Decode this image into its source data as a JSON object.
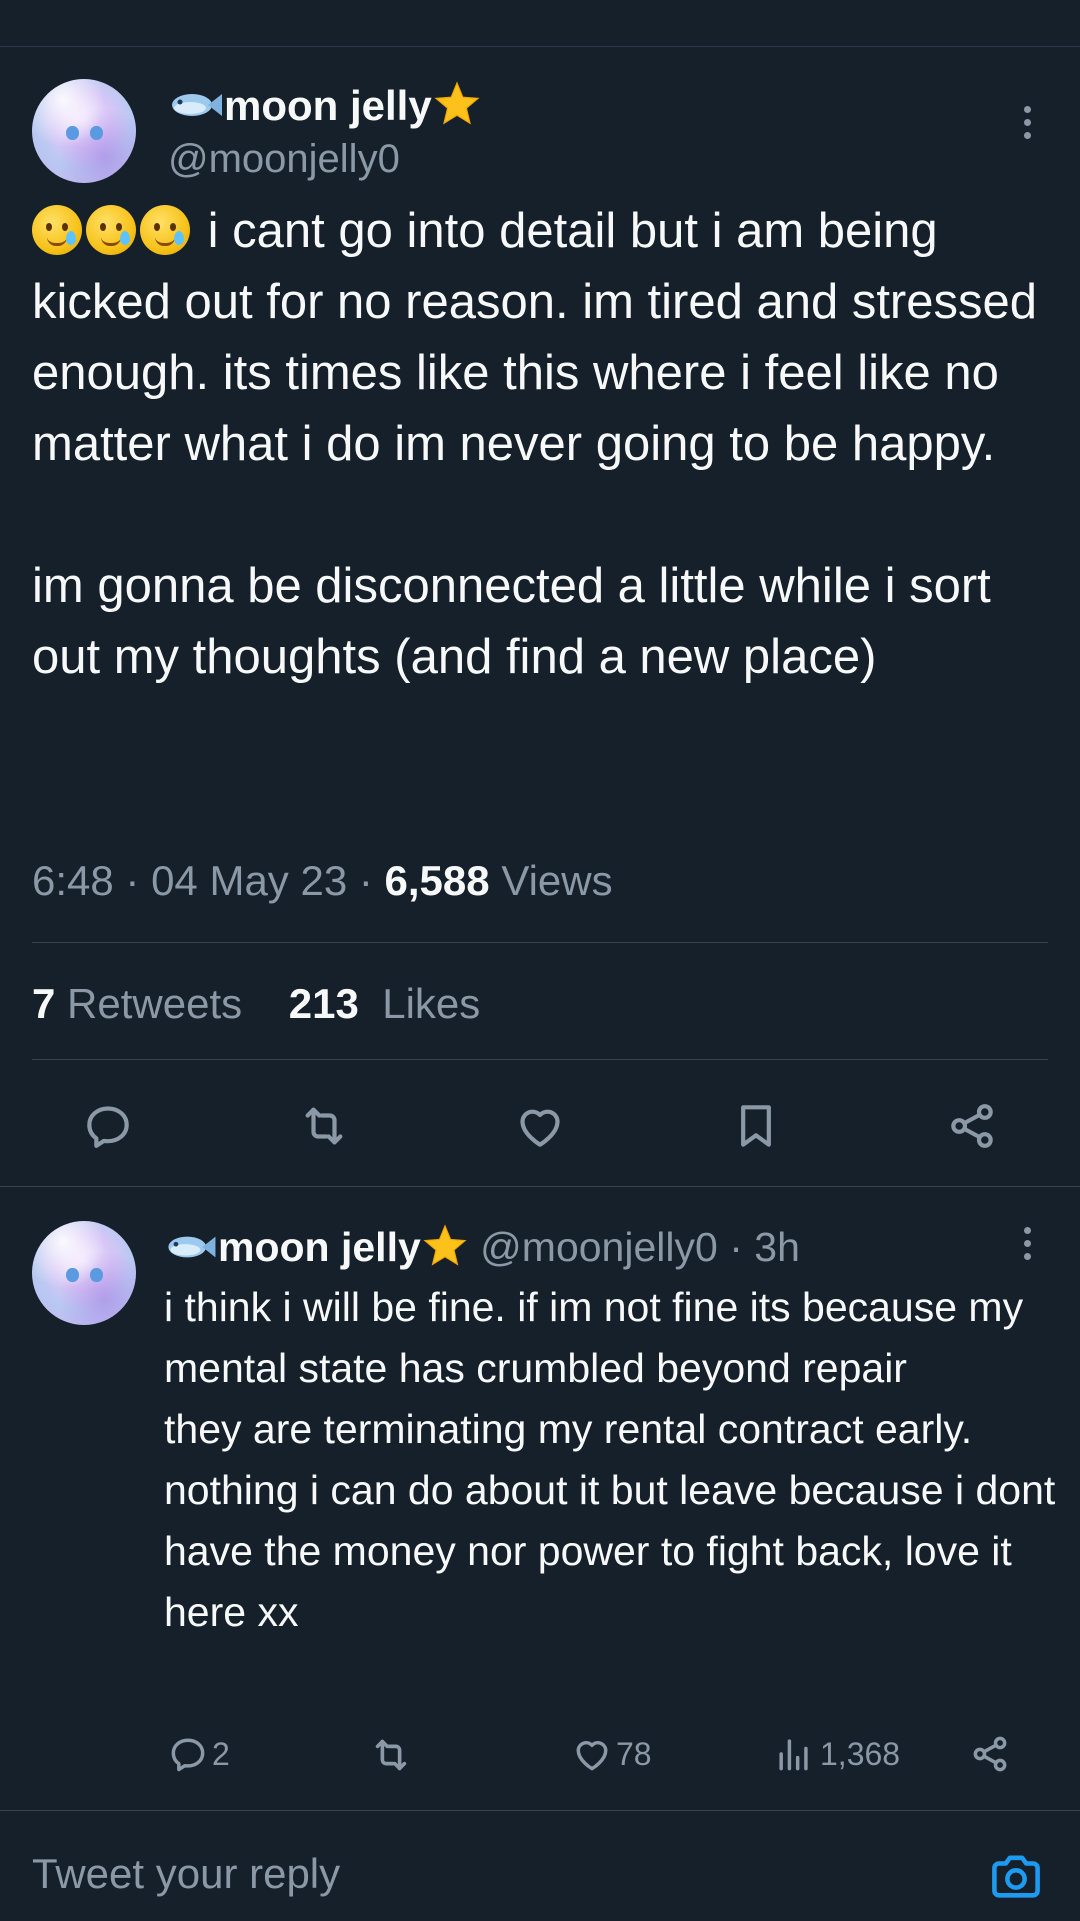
{
  "main_tweet": {
    "display_name": "moon jelly",
    "name_prefix_icon": "fish-emoji-icon",
    "name_suffix_icon": "star-emoji-icon",
    "handle": "@moonjelly0",
    "leading_emoji_icon": "face-holding-back-tears-emoji-icon",
    "paragraph1": "i cant go into detail but i am being kicked out for no reason. im tired and stressed enough. its times like this where i feel like no matter what i do im never going to be happy.",
    "paragraph2": "im gonna be disconnected a little while i sort out my thoughts (and find a new place)",
    "time": "6:48",
    "date": "04 May 23",
    "views_count": "6,588",
    "views_label": "Views",
    "retweets_count": "7",
    "retweets_label": "Retweets",
    "likes_count": "213",
    "likes_label": "Likes"
  },
  "action_bar": {
    "icons": [
      "reply-icon",
      "retweet-icon",
      "like-icon",
      "bookmark-icon",
      "share-icon"
    ]
  },
  "reply": {
    "display_name": "moon jelly",
    "handle": "@moonjelly0",
    "separator": "·",
    "age": "3h",
    "paragraph1": "i think i will be fine. if im not fine its because my mental state has crumbled beyond repair",
    "paragraph2": "they are terminating my rental contract early. nothing i can do about it but leave because i dont have the money nor power to fight back, love it here xx",
    "reply_count": "2",
    "like_count": "78",
    "view_count": "1,368"
  },
  "composer": {
    "placeholder": "Tweet your reply",
    "camera_icon": "camera-icon"
  },
  "colors": {
    "background": "#15202b",
    "text": "#f7f9f9",
    "secondary": "#8b98a5",
    "divider": "#38444d",
    "accent": "#1d9bf0"
  }
}
